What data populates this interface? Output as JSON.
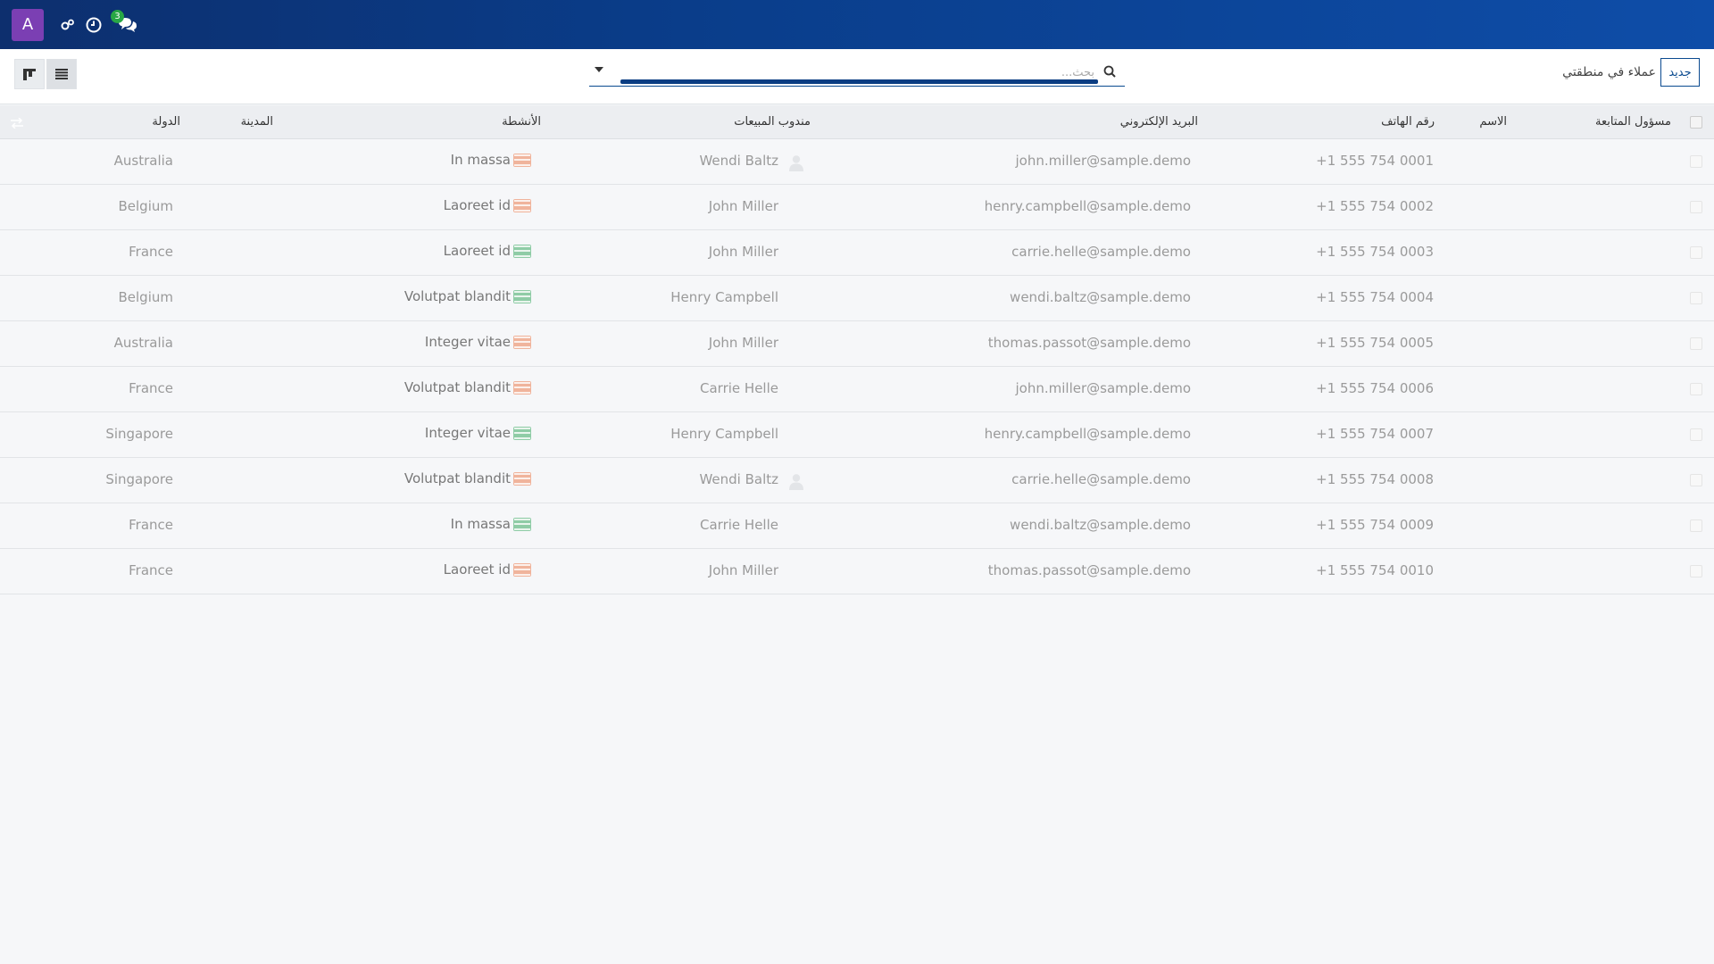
{
  "navbar": {
    "avatar_letter": "A",
    "messages_badge": "3",
    "icons": [
      "gears-icon",
      "clock-icon",
      "comments-icon"
    ]
  },
  "control": {
    "search_placeholder": "بحث...",
    "breadcrumb": "عملاء في منطقتي",
    "new_button": "جديد"
  },
  "table": {
    "headers": {
      "followup": "مسؤول المتابعة",
      "name": "الاسم",
      "phone": "رقم الهاتف",
      "email": "البريد الإلكتروني",
      "salesperson": "مندوب المبيعات",
      "activities": "الأنشطة",
      "city": "المدينة",
      "country": "الدولة"
    },
    "rows": [
      {
        "phone": "+1 555 754 0001",
        "email": "john.miller@sample.demo",
        "salesperson": "Wendi Baltz",
        "avatar": true,
        "activity": "In massa",
        "status": "red",
        "country": "Australia"
      },
      {
        "phone": "+1 555 754 0002",
        "email": "henry.campbell@sample.demo",
        "salesperson": "John Miller",
        "avatar": false,
        "activity": "Laoreet id",
        "status": "red",
        "country": "Belgium"
      },
      {
        "phone": "+1 555 754 0003",
        "email": "carrie.helle@sample.demo",
        "salesperson": "John Miller",
        "avatar": false,
        "activity": "Laoreet id",
        "status": "green",
        "country": "France"
      },
      {
        "phone": "+1 555 754 0004",
        "email": "wendi.baltz@sample.demo",
        "salesperson": "Henry Campbell",
        "avatar": false,
        "activity": "Volutpat blandit",
        "status": "green",
        "country": "Belgium"
      },
      {
        "phone": "+1 555 754 0005",
        "email": "thomas.passot@sample.demo",
        "salesperson": "John Miller",
        "avatar": false,
        "activity": "Integer vitae",
        "status": "red",
        "country": "Australia"
      },
      {
        "phone": "+1 555 754 0006",
        "email": "john.miller@sample.demo",
        "salesperson": "Carrie Helle",
        "avatar": false,
        "activity": "Volutpat blandit",
        "status": "red",
        "country": "France"
      },
      {
        "phone": "+1 555 754 0007",
        "email": "henry.campbell@sample.demo",
        "salesperson": "Henry Campbell",
        "avatar": false,
        "activity": "Integer vitae",
        "status": "green",
        "country": "Singapore"
      },
      {
        "phone": "+1 555 754 0008",
        "email": "carrie.helle@sample.demo",
        "salesperson": "Wendi Baltz",
        "avatar": true,
        "activity": "Volutpat blandit",
        "status": "red",
        "country": "Singapore"
      },
      {
        "phone": "+1 555 754 0009",
        "email": "wendi.baltz@sample.demo",
        "salesperson": "Carrie Helle",
        "avatar": false,
        "activity": "In massa",
        "status": "green",
        "country": "France"
      },
      {
        "phone": "+1 555 754 0010",
        "email": "thomas.passot@sample.demo",
        "salesperson": "John Miller",
        "avatar": false,
        "activity": "Laoreet id",
        "status": "red",
        "country": "France"
      }
    ]
  },
  "colors": {
    "navbar": "#0a3d8a",
    "avatar": "#7b3fb3",
    "badge": "#28a745",
    "activity_overdue": "#f0b49c",
    "activity_planned": "#8fcca6"
  }
}
